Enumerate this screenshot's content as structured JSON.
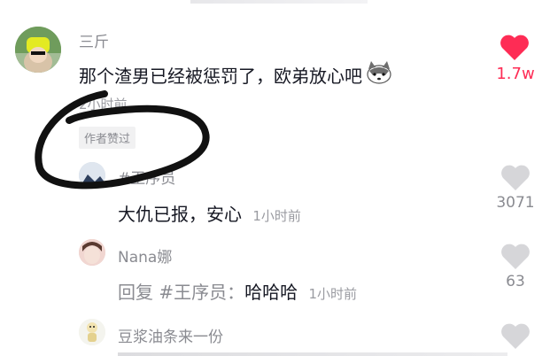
{
  "main_comment": {
    "username": "三斤",
    "text": "那个渣男已经被惩罚了，欧弟放心吧",
    "time": "2小时前",
    "author_liked_tag": "作者赞过",
    "like_count": "1.7w"
  },
  "replies": [
    {
      "username": "#王序员",
      "text": "大仇已报，安心",
      "time": "1小时前",
      "like_count": "3071"
    },
    {
      "username": "Nana娜",
      "reply_prefix": "回复 #王序员：",
      "text": "哈哈哈",
      "time": "1小时前",
      "like_count": "63"
    },
    {
      "username": "豆浆油条来一份"
    }
  ],
  "colors": {
    "liked_heart": "#fe2c55",
    "unliked_heart": "#d6d6d9",
    "annotation_stroke": "#111111"
  },
  "icons": [
    "dog-emoji-icon",
    "heart-icon"
  ]
}
